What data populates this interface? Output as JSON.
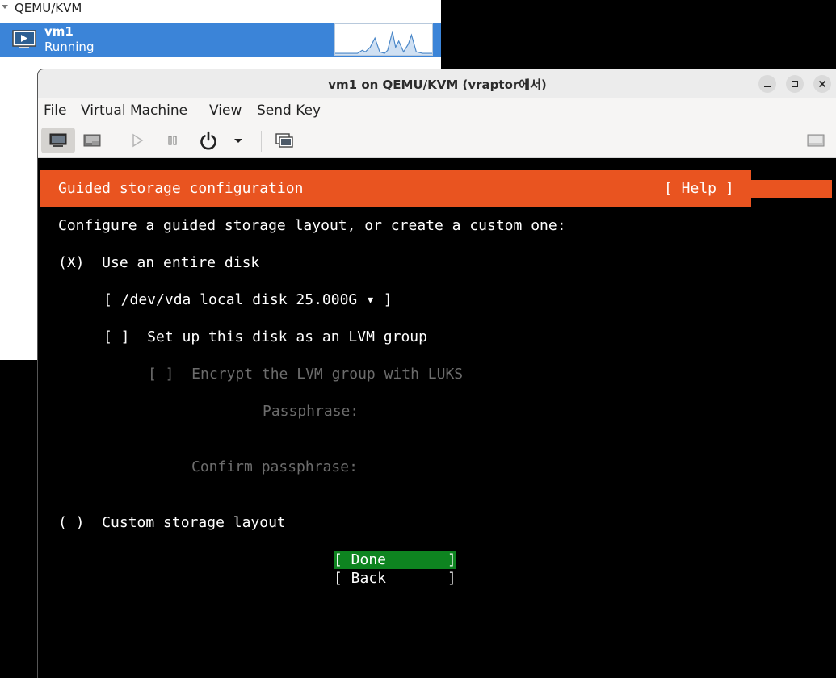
{
  "manager": {
    "connection_label": "QEMU/KVM",
    "vm_name": "vm1",
    "vm_status": "Running"
  },
  "window": {
    "title": "vm1 on QEMU/KVM (vraptor에서)"
  },
  "menubar": {
    "file": "File",
    "virtual_machine": "Virtual Machine",
    "view": "View",
    "send_key": "Send Key"
  },
  "toolbar": {
    "icons": [
      "monitor-icon",
      "details-icon",
      "play-icon",
      "pause-icon",
      "power-icon",
      "chevron-down-icon",
      "snapshot-icon",
      "fullscreen-icon"
    ]
  },
  "installer": {
    "header_title": "Guided storage configuration",
    "help_button": "[ Help ]",
    "intro": "Configure a guided storage layout, or create a custom one:",
    "use_entire_disk": "(X)  Use an entire disk",
    "disk_select": "[ /dev/vda local disk 25.000G ▾ ]",
    "lvm_checkbox": "[ ]  Set up this disk as an LVM group",
    "luks_checkbox": "[ ]  Encrypt the LVM group with LUKS",
    "passphrase_label": "Passphrase:",
    "confirm_passphrase_label": "Confirm passphrase:",
    "custom_layout": "( )  Custom storage layout",
    "done_button": "[ Done       ]",
    "back_button": "[ Back       ]"
  },
  "colors": {
    "header_orange": "#e95420",
    "done_green": "#0e8420",
    "selection_blue": "#3b84d8"
  }
}
